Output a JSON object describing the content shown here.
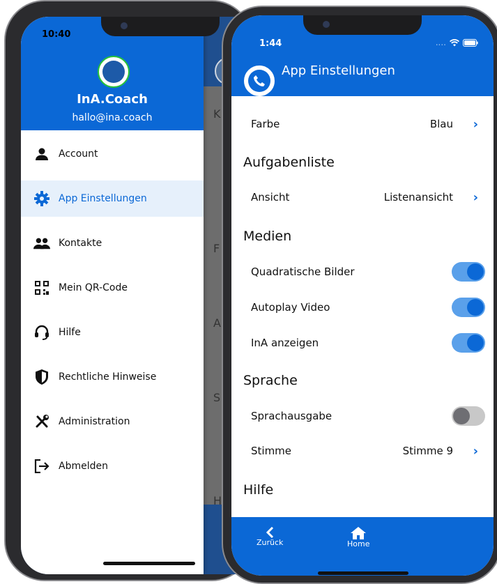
{
  "left_phone": {
    "status_time": "10:40",
    "profile": {
      "name": "InA.Coach",
      "email": "hallo@ina.coach"
    },
    "menu": [
      {
        "label": "Account",
        "icon": "person-icon",
        "active": false
      },
      {
        "label": "App Einstellungen",
        "icon": "gear-icon",
        "active": true
      },
      {
        "label": "Kontakte",
        "icon": "people-icon",
        "active": false
      },
      {
        "label": "Mein QR-Code",
        "icon": "qr-code-icon",
        "active": false
      },
      {
        "label": "Hilfe",
        "icon": "headset-icon",
        "active": false
      },
      {
        "label": "Rechtliche Hinweise",
        "icon": "shield-icon",
        "active": false
      },
      {
        "label": "Administration",
        "icon": "tools-icon",
        "active": false
      },
      {
        "label": "Abmelden",
        "icon": "logout-icon",
        "active": false
      }
    ],
    "background_letters": [
      "K",
      "F",
      "A",
      "S",
      "H"
    ]
  },
  "right_phone": {
    "status_time": "1:44",
    "status_extra": "....",
    "title": "App Einstellungen",
    "rows": {
      "farbe": {
        "label": "Farbe",
        "value": "Blau"
      },
      "ansicht": {
        "label": "Ansicht",
        "value": "Listenansicht"
      },
      "stimme": {
        "label": "Stimme",
        "value": "Stimme 9"
      }
    },
    "sections": {
      "aufgabenliste": "Aufgabenliste",
      "medien": "Medien",
      "sprache": "Sprache",
      "hilfe": "Hilfe"
    },
    "toggles": {
      "quadratische_bilder": {
        "label": "Quadratische Bilder",
        "on": true
      },
      "autoplay_video": {
        "label": "Autoplay Video",
        "on": true
      },
      "ina_anzeigen": {
        "label": "InA anzeigen",
        "on": true
      },
      "sprachausgabe": {
        "label": "Sprachausgabe",
        "on": false
      }
    },
    "footer": {
      "back_label": "Zurück",
      "home_label": "Home"
    }
  },
  "colors": {
    "primary": "#0b68d6",
    "active_bg": "#e6f0fb",
    "toggle_on_track": "#5aa0ea"
  }
}
